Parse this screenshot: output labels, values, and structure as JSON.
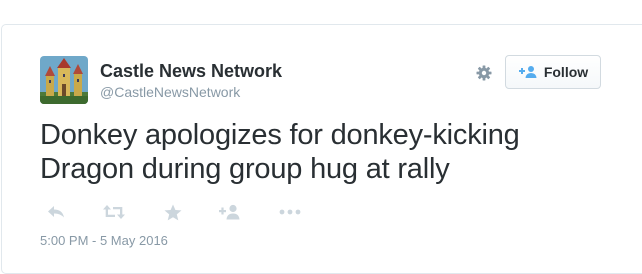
{
  "tweet": {
    "author": {
      "name": "Castle News Network",
      "handle": "@CastleNewsNetwork"
    },
    "follow_label": "Follow",
    "text_line1": "Donkey apologizes for donkey-kicking",
    "text_line2": "Dragon during group hug at rally",
    "timestamp": "5:00 PM - 5 May 2016"
  },
  "icons": {
    "settings": "gear-icon",
    "follow": "add-user-icon",
    "reply": "reply-icon",
    "retweet": "retweet-icon",
    "like": "star-icon",
    "follow_action": "add-user-icon",
    "more": "more-dots-icon"
  },
  "colors": {
    "text": "#292f33",
    "muted": "#8899a6",
    "icon_gray": "#ccd6dd",
    "follow_icon": "#55acee",
    "border": "#e1e8ed"
  }
}
